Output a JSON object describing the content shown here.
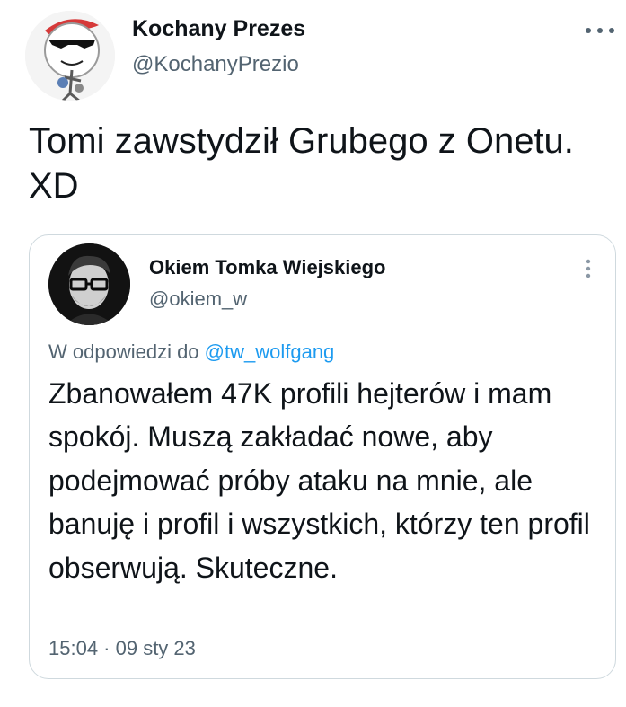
{
  "tweet": {
    "author_name": "Kochany Prezes",
    "author_handle": "@KochanyPrezio",
    "more_icon": "more-horizontal-icon",
    "text": "Tomi zawstydził Grubego z Onetu. XD"
  },
  "quoted": {
    "author_name": "Okiem Tomka Wiejskiego",
    "author_handle": "@okiem_w",
    "more_icon": "more-vertical-icon",
    "reply_prefix": "W odpowiedzi do ",
    "reply_to": "@tw_wolfgang",
    "text": "Zbanowałem 47K profili hejterów i mam spokój. Muszą zakładać nowe, aby podejmować próby ataku na mnie, ale banuję i profil i wszystkich, którzy ten profil obserwują. Skuteczne.",
    "timestamp": "15:04 · 09 sty 23"
  },
  "colors": {
    "primary_text": "#0f1419",
    "secondary_text": "#536471",
    "link": "#1d9bf0",
    "border": "#cfd9de"
  }
}
